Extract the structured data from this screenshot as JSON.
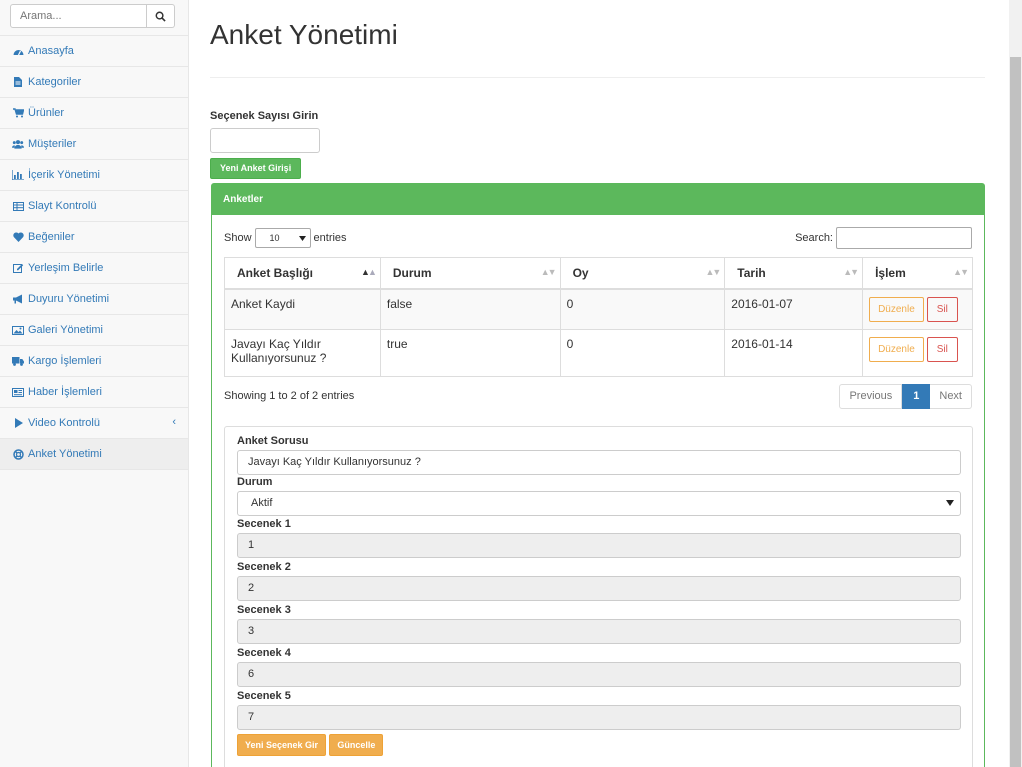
{
  "sidebar": {
    "search_placeholder": "Arama...",
    "items": [
      {
        "label": "Anasayfa",
        "icon": "dashboard-icon"
      },
      {
        "label": "Kategoriler",
        "icon": "file-icon"
      },
      {
        "label": "Ürünler",
        "icon": "cart-icon"
      },
      {
        "label": "Müşteriler",
        "icon": "users-icon"
      },
      {
        "label": "İçerik Yönetimi",
        "icon": "bar-chart-icon"
      },
      {
        "label": "Slayt Kontrolü",
        "icon": "table-icon"
      },
      {
        "label": "Beğeniler",
        "icon": "heart-icon"
      },
      {
        "label": "Yerleşim Belirle",
        "icon": "edit-icon"
      },
      {
        "label": "Duyuru Yönetimi",
        "icon": "bullhorn-icon"
      },
      {
        "label": "Galeri Yönetimi",
        "icon": "image-icon"
      },
      {
        "label": "Kargo İşlemleri",
        "icon": "truck-icon"
      },
      {
        "label": "Haber İşlemleri",
        "icon": "newspaper-icon"
      },
      {
        "label": "Video Kontrolü",
        "icon": "play-icon",
        "arrow": "‹"
      },
      {
        "label": "Anket Yönetimi",
        "icon": "life-ring-icon",
        "active": true
      }
    ]
  },
  "main": {
    "title": "Anket Yönetimi",
    "count_label": "Seçenek Sayısı Girin",
    "new_button": "Yeni Anket Girişi"
  },
  "panel": {
    "title": "Anketler",
    "show_label": "Show",
    "entries_value": "10",
    "entries_label": "entries",
    "search_label": "Search:",
    "columns": [
      "Anket Başlığı",
      "Durum",
      "Oy",
      "Tarih",
      "İşlem"
    ],
    "rows": [
      {
        "title": "Anket Kaydi",
        "durum": "false",
        "oy": "0",
        "tarih": "2016-01-07"
      },
      {
        "title": "Javayı Kaç Yıldır Kullanıyorsunuz ?",
        "durum": "true",
        "oy": "0",
        "tarih": "2016-01-14"
      }
    ],
    "edit_label": "Düzenle",
    "delete_label": "Sil",
    "info": "Showing 1 to 2 of 2 entries",
    "pager": {
      "previous": "Previous",
      "page": "1",
      "next": "Next"
    }
  },
  "form": {
    "question_label": "Anket Sorusu",
    "question_value": "Javayı Kaç Yıldır Kullanıyorsunuz ?",
    "status_label": "Durum",
    "status_value": "Aktif",
    "options": [
      {
        "label": "Secenek 1",
        "value": "1"
      },
      {
        "label": "Secenek 2",
        "value": "2"
      },
      {
        "label": "Secenek 3",
        "value": "3"
      },
      {
        "label": "Secenek 4",
        "value": "6"
      },
      {
        "label": "Secenek 5",
        "value": "7"
      }
    ],
    "add_option_button": "Yeni Seçenek Gir",
    "update_button": "Güncelle"
  },
  "colors": {
    "green": "#5cb85c",
    "blue": "#337ab7",
    "orange": "#f0ad4e",
    "red": "#d9534f"
  }
}
